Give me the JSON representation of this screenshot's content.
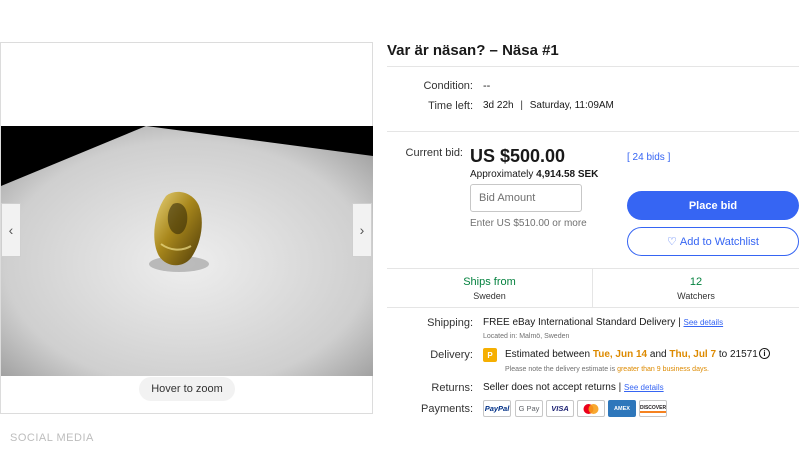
{
  "listing": {
    "title": "Var är näsan? – Näsa #1"
  },
  "details": {
    "condition_label": "Condition:",
    "condition_value": "--",
    "time_left_label": "Time left:",
    "time_left_value": "3d 22h",
    "time_left_separator": "|",
    "time_left_end": "Saturday, 11:09AM"
  },
  "bid": {
    "current_bid_label": "Current bid:",
    "price": "US $500.00",
    "approx_prefix": "Approximately",
    "approx_value": "4,914.58 SEK",
    "bids_count": "[ 24 bids ]",
    "input_placeholder": "Bid Amount",
    "enter_hint": "Enter US $510.00 or more",
    "place_bid_label": "Place bid",
    "watchlist_label": "Add to Watchlist"
  },
  "shipping_summary": {
    "ships_from_label": "Ships from",
    "ships_from_value": "Sweden",
    "watchers_count": "12",
    "watchers_label": "Watchers"
  },
  "shipping": {
    "label": "Shipping:",
    "value": "FREE eBay International Standard Delivery",
    "separator": "|",
    "see_details": "See details",
    "located": "Located in: Malmö, Sweden"
  },
  "delivery": {
    "label": "Delivery:",
    "badge": "P",
    "estimated_prefix": "Estimated between",
    "date_start": "Tue, Jun 14",
    "and": "and",
    "date_end": "Thu, Jul 7",
    "to_zip": "to 21571",
    "note_prefix": "Please note the delivery estimate is",
    "note_highlight": "greater than 9 business days."
  },
  "returns": {
    "label": "Returns:",
    "value": "Seller does not accept returns",
    "separator": "|",
    "see_details": "See details"
  },
  "payments": {
    "label": "Payments:",
    "methods": [
      "PayPal",
      "G Pay",
      "VISA",
      "Mastercard",
      "AMEX",
      "DISCOVER"
    ]
  },
  "gallery": {
    "hover_zoom": "Hover to zoom",
    "prev_icon": "‹",
    "next_icon": "›"
  },
  "watermark": "SOCIAL MEDIA",
  "colors": {
    "accent": "#3665f3",
    "green": "#05823f",
    "orange": "#dd8a00"
  }
}
